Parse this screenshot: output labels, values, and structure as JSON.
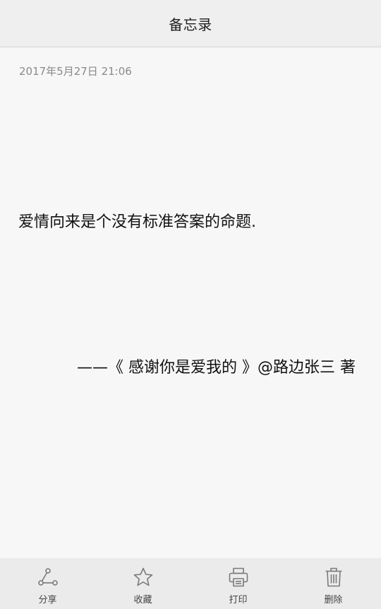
{
  "header": {
    "title": "备忘录"
  },
  "note": {
    "timestamp": "2017年5月27日 21:06",
    "body": "爱情向来是个没有标准答案的命题.",
    "signature": "——《 感谢你是爱我的 》@路边张三 著"
  },
  "toolbar": {
    "items": [
      {
        "label": "分享",
        "icon": "share-icon"
      },
      {
        "label": "收藏",
        "icon": "star-icon"
      },
      {
        "label": "打印",
        "icon": "printer-icon"
      },
      {
        "label": "删除",
        "icon": "trash-icon"
      }
    ]
  },
  "colors": {
    "background": "#f7f7f7",
    "header": "#efefef",
    "toolbar": "#ebebeb",
    "icon": "#7a7a7a"
  }
}
